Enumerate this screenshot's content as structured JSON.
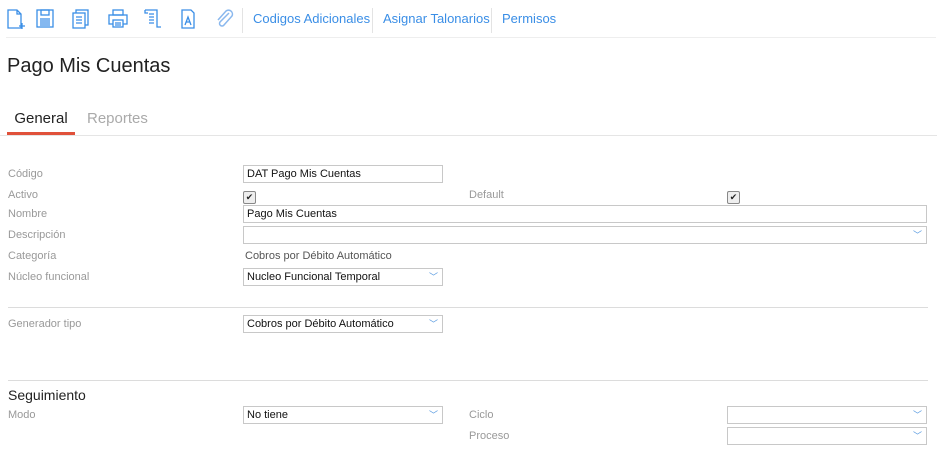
{
  "toolbar": {
    "icons": [
      "new-document-icon",
      "save-icon",
      "copy-icon",
      "print-icon",
      "scroll-icon",
      "font-document-icon",
      "paperclip-icon"
    ],
    "links": [
      "Codigos Adicionales",
      "Asignar Talonarios",
      "Permisos"
    ]
  },
  "page_title": "Pago Mis Cuentas",
  "tabs": [
    "General",
    "Reportes"
  ],
  "accent": "#e0513a",
  "form": {
    "codigo": {
      "label": "Código",
      "value": "DAT Pago Mis Cuentas"
    },
    "activo": {
      "label": "Activo",
      "checked": true
    },
    "default": {
      "label": "Default",
      "checked": true
    },
    "nombre": {
      "label": "Nombre",
      "value": "Pago Mis Cuentas"
    },
    "descripcion": {
      "label": "Descripción",
      "value": ""
    },
    "categoria": {
      "label": "Categoría",
      "value": "Cobros por Débito Automático"
    },
    "nucleo": {
      "label": "Núcleo funcional",
      "value": "Nucleo Funcional Temporal"
    },
    "generador": {
      "label": "Generador tipo",
      "value": "Cobros por Débito Automático"
    }
  },
  "seguimiento": {
    "title": "Seguimiento",
    "modo": {
      "label": "Modo",
      "value": "No tiene"
    },
    "ciclo": {
      "label": "Ciclo",
      "value": ""
    },
    "proceso": {
      "label": "Proceso",
      "value": ""
    }
  }
}
